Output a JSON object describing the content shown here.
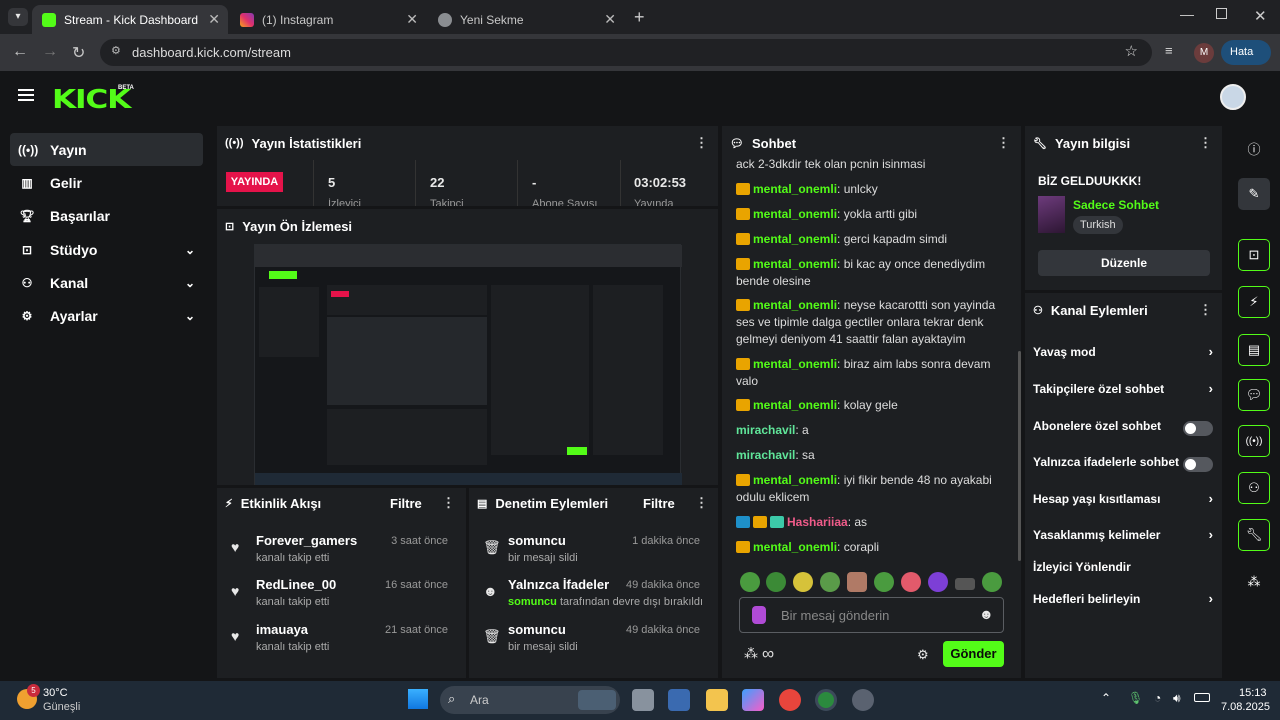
{
  "browser": {
    "tabs": [
      {
        "label": "Stream - Kick Dashboard"
      },
      {
        "label": "(1) Instagram"
      },
      {
        "label": "Yeni Sekme"
      }
    ],
    "url": "dashboard.kick.com/stream",
    "profile_letter": "M",
    "error_label": "Hata"
  },
  "header": {
    "logo": "KICK",
    "beta": "BETA"
  },
  "sidebar": {
    "items": [
      {
        "label": "Yayın",
        "icon": "broadcast-icon"
      },
      {
        "label": "Gelir",
        "icon": "chart-icon"
      },
      {
        "label": "Başarılar",
        "icon": "trophy-icon"
      },
      {
        "label": "Stüdyo",
        "icon": "studio-icon"
      },
      {
        "label": "Kanal",
        "icon": "channel-icon"
      },
      {
        "label": "Ayarlar",
        "icon": "gear-icon"
      }
    ]
  },
  "stats": {
    "title": "Yayın İstatistikleri",
    "live_badge": "YAYINDA",
    "values": [
      "5",
      "22",
      "-",
      "03:02:53"
    ],
    "labels": [
      "İzleyici",
      "Takipçi",
      "Abone Sayısı",
      "Yayında"
    ]
  },
  "preview": {
    "title": "Yayın Ön İzlemesi"
  },
  "activity": {
    "title": "Etkinlik Akışı",
    "filter": "Filtre",
    "items": [
      {
        "name": "Forever_gamers",
        "sub": "kanalı takip etti",
        "time": "3 saat önce"
      },
      {
        "name": "RedLinee_00",
        "sub": "kanalı takip etti",
        "time": "16 saat önce"
      },
      {
        "name": "imauaya",
        "sub": "kanalı takip etti",
        "time": "21 saat önce"
      }
    ]
  },
  "moderation": {
    "title": "Denetim Eylemleri",
    "filter": "Filtre",
    "items": [
      {
        "name": "somuncu",
        "sub": "bir mesajı sildi",
        "time": "1 dakika önce"
      },
      {
        "name": "Yalnızca İfadeler",
        "sub_user": "somuncu",
        "sub": "tarafından devre dışı bırakıldı",
        "time": "49 dakika önce"
      },
      {
        "name": "somuncu",
        "sub": "bir mesajı sildi",
        "time": "49 dakika önce"
      }
    ]
  },
  "chat": {
    "title": "Sohbet",
    "top_line": "ack 2-3dkdir tek olan pcnin isinmasi",
    "messages": [
      {
        "user": "mental_onemli",
        "text": "unlcky"
      },
      {
        "user": "mental_onemli",
        "text": "yokla artti gibi"
      },
      {
        "user": "mental_onemli",
        "text": "gerci kapadm simdi"
      },
      {
        "user": "mental_onemli",
        "text": "bi kac ay once denediydim bende olesine"
      },
      {
        "user": "mental_onemli",
        "text": "neyse kacarottti son yayinda ses ve tipimle dalga gectiler onlara tekrar denk gelmeyi deniyom 41 saattir falan ayaktayim"
      },
      {
        "user": "mental_onemli",
        "text": "biraz aim labs sonra devam valo"
      },
      {
        "user": "mental_onemli",
        "text": "kolay gele"
      },
      {
        "user": "mirachavil",
        "text": "a"
      },
      {
        "user": "mirachavil",
        "text": "sa"
      },
      {
        "user": "mental_onemli",
        "text": "iyi fikir bende 48 no ayakabi odulu eklicem"
      },
      {
        "user": "Hashariiaa",
        "text": "as"
      },
      {
        "user": "mental_onemli",
        "text": "corapli"
      }
    ],
    "placeholder": "Bir mesaj gönderin",
    "infinity": "∞",
    "send": "Gönder"
  },
  "stream_info": {
    "title": "Yayın bilgisi",
    "stream_title": "BİZ GELDUUKKK!",
    "category": "Sadece Sohbet",
    "tag": "Turkish",
    "edit": "Düzenle"
  },
  "channel_actions": {
    "title": "Kanal Eylemleri",
    "items": [
      "Yavaş mod",
      "Takipçilere özel sohbet",
      "Abonelere özel sohbet",
      "Yalnızca ifadelerle sohbet",
      "Hesap yaşı kısıtlaması",
      "Yasaklanmış kelimeler",
      "İzleyici Yönlendir",
      "Hedefleri belirleyin"
    ]
  },
  "taskbar": {
    "weather_temp": "30°C",
    "weather_desc": "Güneşli",
    "weather_badge": "5",
    "search": "Ara",
    "time": "15:13",
    "date": "7.08.2025"
  },
  "colors": {
    "accent": "#53fc18",
    "live": "#e5134a",
    "panel": "#1d1f22"
  }
}
